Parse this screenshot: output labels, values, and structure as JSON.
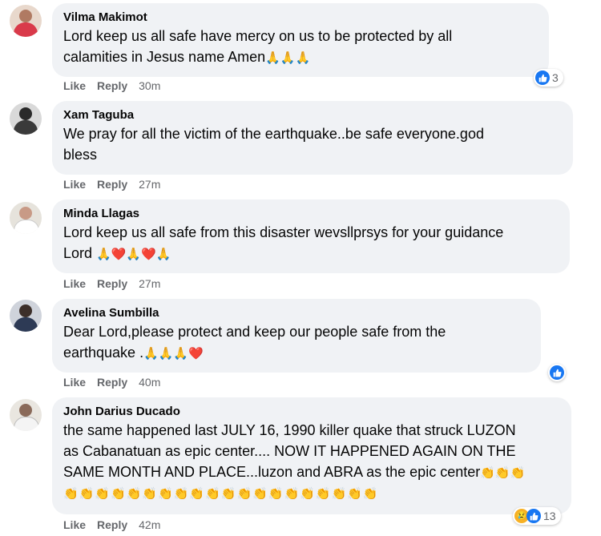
{
  "comments": [
    {
      "name": "Vilma Makimot",
      "lines": [
        "Lord keep us all safe have mercy on us to be protected by all",
        "calamities in Jesus name Amen"
      ],
      "emoji_tail": "🙏🙏🙏",
      "like": "Like",
      "reply": "Reply",
      "time": "30m",
      "reaction_count": "3"
    },
    {
      "name": "Xam Taguba",
      "lines": [
        "We pray for all the victim of the earthquake..be safe everyone.god",
        "bless"
      ],
      "like": "Like",
      "reply": "Reply",
      "time": "27m"
    },
    {
      "name": "Minda Llagas",
      "lines": [
        "Lord keep us all safe from this disaster wevsllprsys for your guidance",
        "Lord"
      ],
      "emoji_tail": "🙏❤️🙏❤️🙏",
      "like": "Like",
      "reply": "Reply",
      "time": "27m"
    },
    {
      "name": "Avelina Sumbilla",
      "lines": [
        "Dear Lord,please protect and keep our people safe from the",
        "earthquake ."
      ],
      "emoji_tail": "🙏🙏🙏❤️",
      "like": "Like",
      "reply": "Reply",
      "time": "40m"
    },
    {
      "name": "John Darius Ducado",
      "lines": [
        "the same happened last JULY 16, 1990 killer quake that struck LUZON",
        "as Cabanatuan as epic center.... NOW IT HAPPENED AGAIN ON THE",
        "SAME MONTH AND PLACE...luzon and ABRA as the epic center"
      ],
      "emoji_tail": "👏👏👏",
      "emoji_line": "👏👏👏👏👏👏👏👏👏👏👏👏👏👏👏👏👏👏👏👏",
      "like": "Like",
      "reply": "Reply",
      "time": "42m",
      "reaction_count": "13"
    }
  ],
  "colors": {
    "bubble": "#f0f2f5",
    "meta_text": "#65676b",
    "like_blue": "#1877f2",
    "sad_yellow": "#f7b125"
  },
  "icons": {
    "like": "thumbs-up-icon",
    "sad": "sad-face-icon"
  }
}
